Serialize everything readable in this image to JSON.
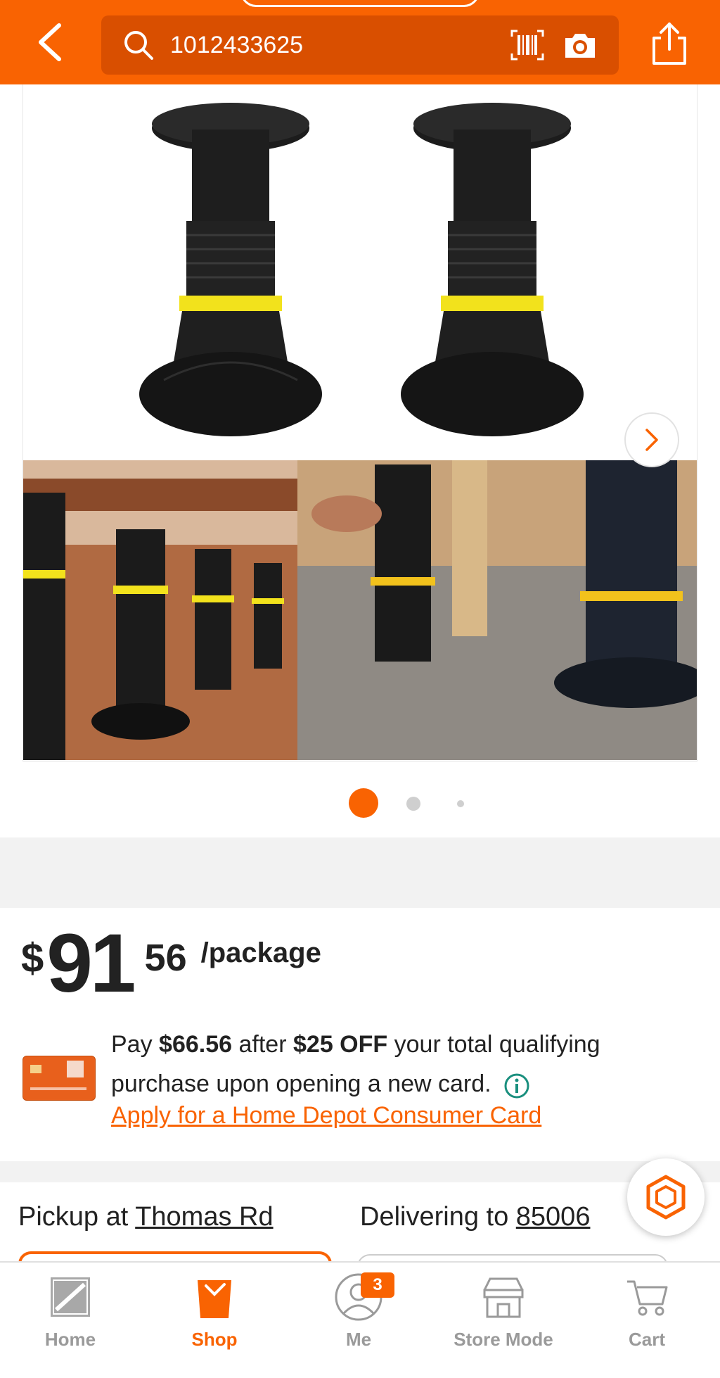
{
  "header": {
    "search_value": "1012433625",
    "colors": {
      "brand": "#f96302"
    },
    "icons": [
      "back-arrow-icon",
      "search-icon",
      "barcode-icon",
      "camera-icon",
      "share-icon"
    ]
  },
  "gallery": {
    "current_index": 1,
    "total_dots": 3
  },
  "price": {
    "currency": "$",
    "dollars": "91",
    "cents": "56",
    "unit": "/package"
  },
  "promo": {
    "pay": "Pay",
    "amount": "$66.56",
    "after": "after",
    "discount": "$25 OFF",
    "rest": "your total qualifying purchase upon opening a new card.",
    "apply_link": "Apply for a Home Depot Consumer Card"
  },
  "fulfillment": {
    "pickup_prefix": "Pickup at",
    "pickup_store": "Thomas Rd",
    "delivery_prefix": "Delivering to",
    "delivery_zip": "85006"
  },
  "tabbar": {
    "tabs": [
      {
        "label": "Home",
        "icon": "home-depot-logo-icon"
      },
      {
        "label": "Shop",
        "icon": "shop-bucket-icon",
        "active": true
      },
      {
        "label": "Me",
        "icon": "person-icon",
        "badge": "3"
      },
      {
        "label": "Store Mode",
        "icon": "store-icon"
      },
      {
        "label": "Cart",
        "icon": "cart-icon"
      }
    ]
  }
}
